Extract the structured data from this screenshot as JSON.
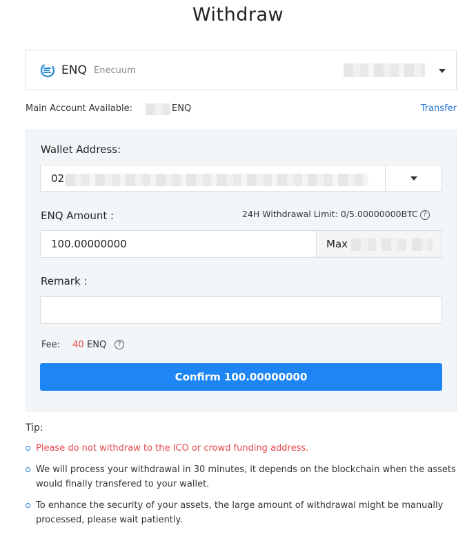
{
  "page": {
    "title": "Withdraw"
  },
  "coin_select": {
    "symbol": "ENQ",
    "name": "Enecuum",
    "logo_color": "#2e8fd6"
  },
  "account": {
    "available_label": "Main Account Available:",
    "available_unit": "ENQ",
    "transfer_label": "Transfer"
  },
  "form": {
    "wallet_label": "Wallet Address:",
    "wallet_value_prefix": "02",
    "amount_label": "ENQ Amount :",
    "limit_text": "24H Withdrawal Limit: 0/5.00000000BTC",
    "amount_value": "100.00000000",
    "max_label": "Max",
    "remark_label": "Remark :",
    "remark_value": "",
    "fee_label": "Fee:",
    "fee_value": "40",
    "fee_unit": "ENQ",
    "help_glyph": "?",
    "confirm_label": "Confirm 100.00000000"
  },
  "tips": {
    "title": "Tip:",
    "items": [
      "Please do not withdraw to the ICO or crowd funding address.",
      "We will process your withdrawal in 30 minutes, it depends on the blockchain when the assets would finally transfered to your wallet.",
      "To enhance the security of your assets, the large amount of withdrawal might be manually processed, please wait patiently."
    ]
  },
  "colors": {
    "accent": "#1e85f4",
    "link": "#2478d4",
    "warning": "#e8474c",
    "panel_bg": "#f3f6f8"
  }
}
